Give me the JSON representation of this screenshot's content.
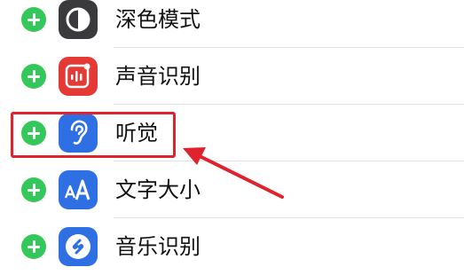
{
  "items": [
    {
      "label": "深色模式",
      "icon": "dark-mode-icon",
      "color": "#3a3a3c"
    },
    {
      "label": "声音识别",
      "icon": "sound-recognition-icon",
      "color": "#e53935"
    },
    {
      "label": "听觉",
      "icon": "hearing-icon",
      "color": "#2f6fe4"
    },
    {
      "label": "文字大小",
      "icon": "text-size-icon",
      "color": "#2f6fe4"
    },
    {
      "label": "音乐识别",
      "icon": "shazam-icon",
      "color": "#2f6fe4"
    }
  ],
  "colors": {
    "add": "#34c759",
    "annotation": "#e0222e"
  }
}
